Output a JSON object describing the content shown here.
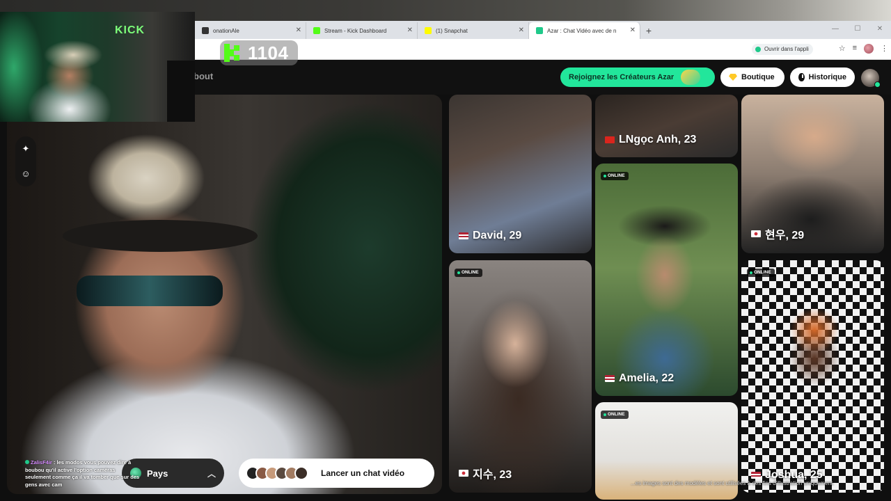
{
  "browser": {
    "tabs": [
      {
        "label": "onationAle",
        "active": false,
        "favicon_color": "#333333"
      },
      {
        "label": "Stream - Kick Dashboard",
        "active": false,
        "favicon_color": "#53fc18"
      },
      {
        "label": "(1) Snapchat",
        "active": false,
        "favicon_color": "#fffc00"
      },
      {
        "label": "Azar : Chat Vidéo avec de n",
        "active": true,
        "favicon_color": "#1fc98a"
      }
    ],
    "new_tab": "+",
    "open_in_app": "Ouvrir dans l'appli"
  },
  "kick_counter": {
    "value": "1104"
  },
  "header": {
    "about_label": "bout",
    "creators_label": "Rejoignez les Créateurs Azar",
    "shop_label": "Boutique",
    "history_label": "Historique"
  },
  "webcam": {
    "sign": "KICK"
  },
  "chat": {
    "username": "ZalisF4ir",
    "message": ": les modos vous pouvez dire à boubou qu'il active l'option caméras seulement comme ça il va tomber que sur des gens avec cam"
  },
  "controls": {
    "country_label": "Pays",
    "launch_label": "Lancer un chat vidéo"
  },
  "cards": {
    "online_label": "ONLINE",
    "col1": [
      {
        "name": "David, 29",
        "online": false
      },
      {
        "name": "지수, 23",
        "online": true
      }
    ],
    "col2": [
      {
        "name": "LNgọc Anh, 23",
        "online": false
      },
      {
        "name": "Amelia, 22",
        "online": true
      },
      {
        "name": "",
        "online": true
      }
    ],
    "col3": [
      {
        "name": "현우, 29",
        "online": false
      },
      {
        "name": "Joshua, 25",
        "online": true
      }
    ]
  },
  "disclaimer": "...es images sont des modèles et sont utilisées à des fins d'illustration uniquement.",
  "colors": {
    "accent": "#22e69b",
    "kick_green": "#53fc18"
  }
}
